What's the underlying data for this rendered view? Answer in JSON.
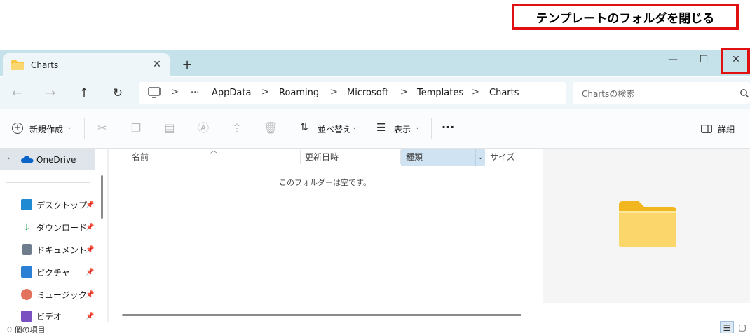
{
  "annotation": {
    "label": "テンプレートのフォルダを閉じる",
    "color": "#e01010"
  },
  "tab": {
    "title": "Charts",
    "close_icon": "close-icon",
    "new_tab_label": "+"
  },
  "window": {
    "minimize_label": "—",
    "maximize_label": "☐",
    "close_label": "✕"
  },
  "nav_buttons": {
    "back": "←",
    "forward": "→",
    "up": "↑",
    "refresh": "↻"
  },
  "breadcrumb": {
    "overflow": "···",
    "items": [
      "AppData",
      "Roaming",
      "Microsoft",
      "Templates",
      "Charts"
    ],
    "separator": ">"
  },
  "search": {
    "placeholder": "Chartsの検索"
  },
  "toolbar": {
    "new_label": "新規作成",
    "sort_label": "並べ替え",
    "view_label": "表示",
    "more_label": "···",
    "details_label": "詳細"
  },
  "nav_pane": {
    "onedrive": "OneDrive",
    "items": [
      {
        "label": "デスクトップ",
        "icon": "desktop-icon"
      },
      {
        "label": "ダウンロード",
        "icon": "download-icon"
      },
      {
        "label": "ドキュメント",
        "icon": "document-icon"
      },
      {
        "label": "ピクチャ",
        "icon": "picture-icon"
      },
      {
        "label": "ミュージック",
        "icon": "music-icon"
      },
      {
        "label": "ビデオ",
        "icon": "video-icon"
      }
    ]
  },
  "columns": {
    "name": "名前",
    "date": "更新日時",
    "type": "種類",
    "size": "サイズ"
  },
  "content": {
    "empty_message": "このフォルダーは空です。"
  },
  "status": {
    "item_count": "0 個の項目"
  },
  "colors": {
    "titlebar": "#c5e1ea",
    "accent": "#0067c0",
    "folder": "#f7c744"
  }
}
